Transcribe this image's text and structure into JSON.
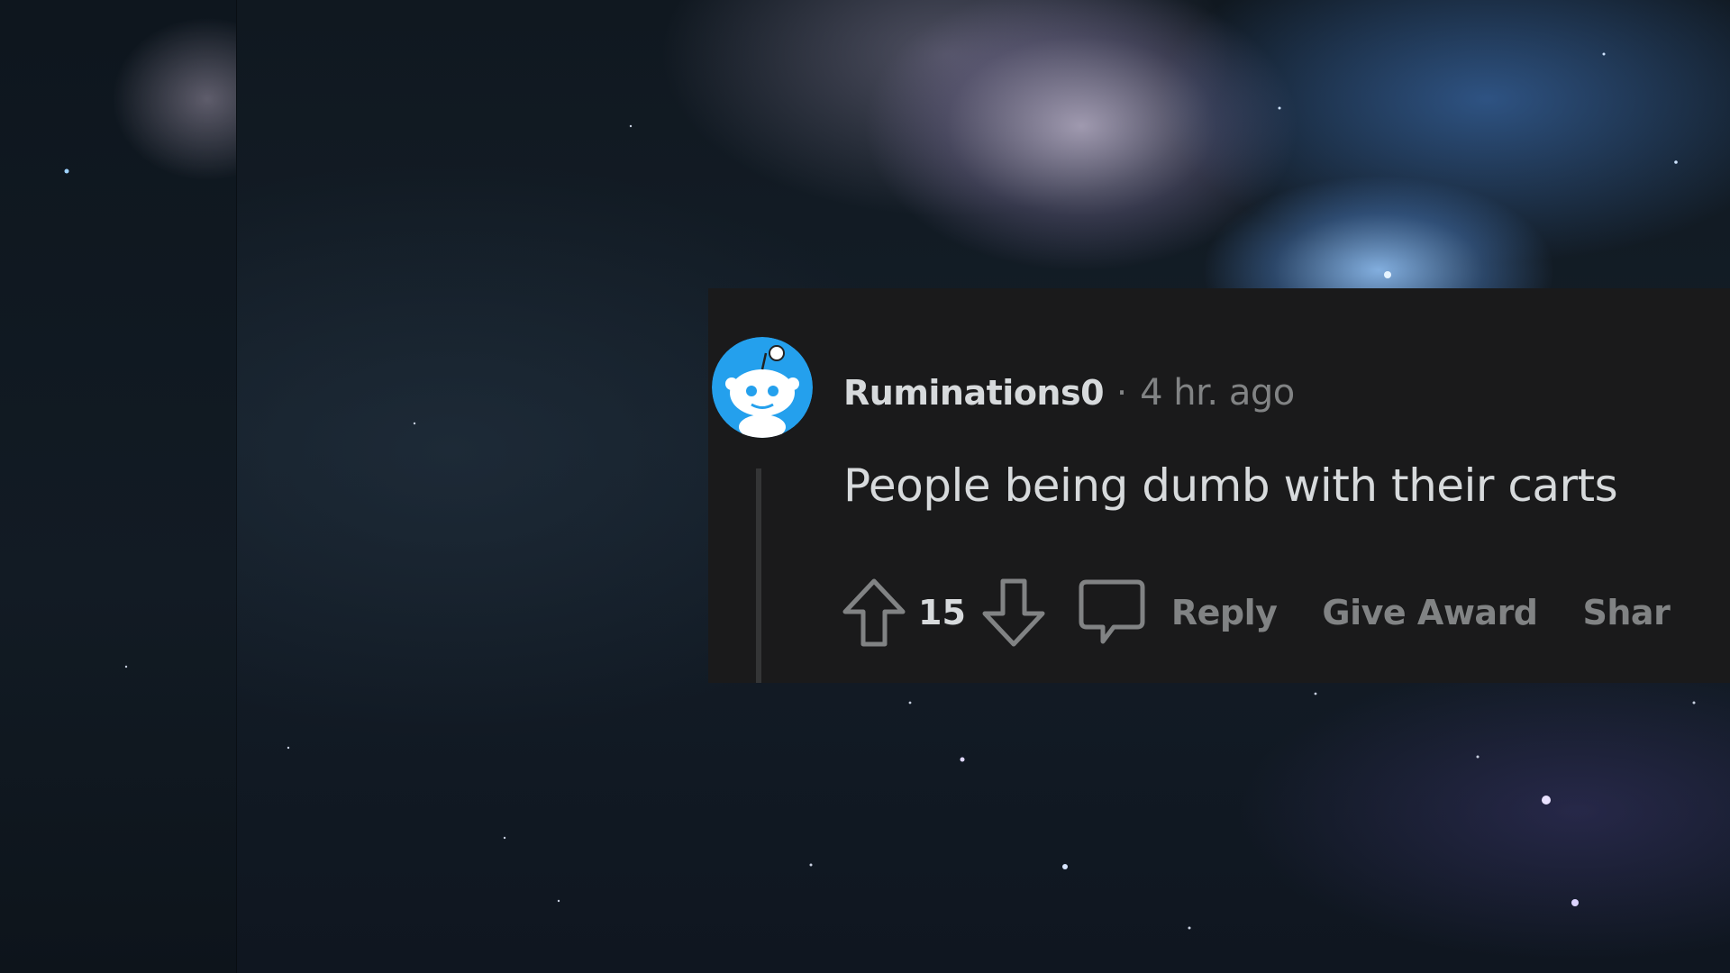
{
  "comment": {
    "username": "Ruminations0",
    "separator": "·",
    "timestamp": "4 hr. ago",
    "body": "People being dumb with their carts",
    "score": "15"
  },
  "actions": {
    "reply_label": "Reply",
    "award_label": "Give Award",
    "share_label": "Shar"
  },
  "icons": {
    "upvote": "arrow-up-icon",
    "downvote": "arrow-down-icon",
    "reply": "speech-bubble-icon",
    "avatar": "snoo-avatar"
  },
  "colors": {
    "card_bg": "#1a1a1b",
    "text_primary": "#d7dadc",
    "text_muted": "#818384",
    "avatar_blue": "#24a0ed",
    "thread_line": "#343536"
  }
}
